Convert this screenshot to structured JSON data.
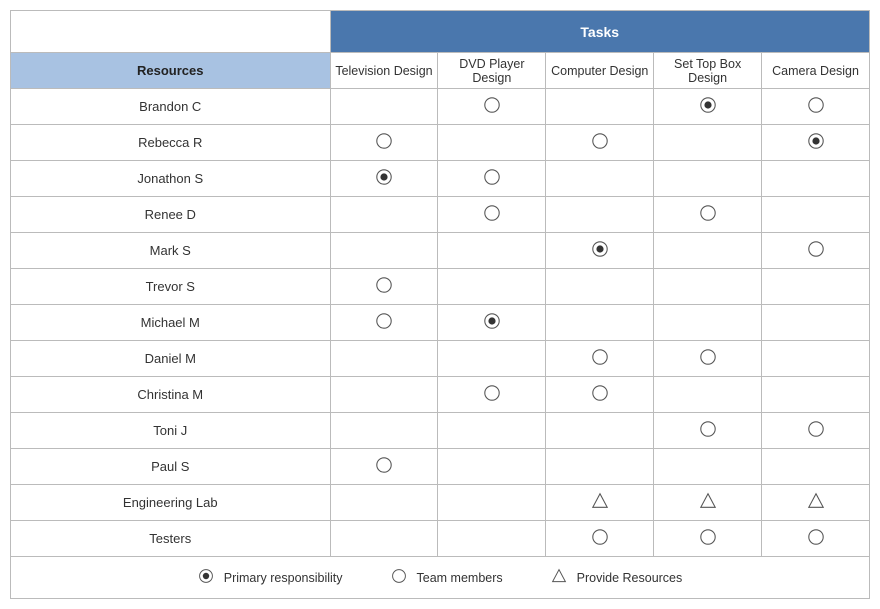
{
  "header": {
    "tasks_label": "Tasks",
    "resources_label": "Resources"
  },
  "tasks": [
    "Television Design",
    "DVD Player Design",
    "Computer Design",
    "Set Top Box Design",
    "Camera Design"
  ],
  "resources": [
    "Brandon C",
    "Rebecca R",
    "Jonathon S",
    "Renee D",
    "Mark S",
    "Trevor S",
    "Michael M",
    "Daniel M",
    "Christina M",
    "Toni J",
    "Paul S",
    "Engineering Lab",
    "Testers"
  ],
  "matrix": [
    [
      "",
      "open",
      "",
      "filled",
      "open"
    ],
    [
      "open",
      "",
      "open",
      "",
      "filled"
    ],
    [
      "filled",
      "open",
      "",
      "",
      ""
    ],
    [
      "",
      "open",
      "",
      "open",
      ""
    ],
    [
      "",
      "",
      "filled",
      "",
      "open"
    ],
    [
      "open",
      "",
      "",
      "",
      ""
    ],
    [
      "open",
      "filled",
      "",
      "",
      ""
    ],
    [
      "",
      "",
      "open",
      "open",
      ""
    ],
    [
      "",
      "open",
      "open",
      "",
      ""
    ],
    [
      "",
      "",
      "",
      "open",
      "open"
    ],
    [
      "open",
      "",
      "",
      "",
      ""
    ],
    [
      "",
      "",
      "triangle",
      "triangle",
      "triangle"
    ],
    [
      "",
      "",
      "open",
      "open",
      "open"
    ]
  ],
  "legend": {
    "primary": "Primary responsibility",
    "team": "Team members",
    "provide": "Provide Resources"
  }
}
